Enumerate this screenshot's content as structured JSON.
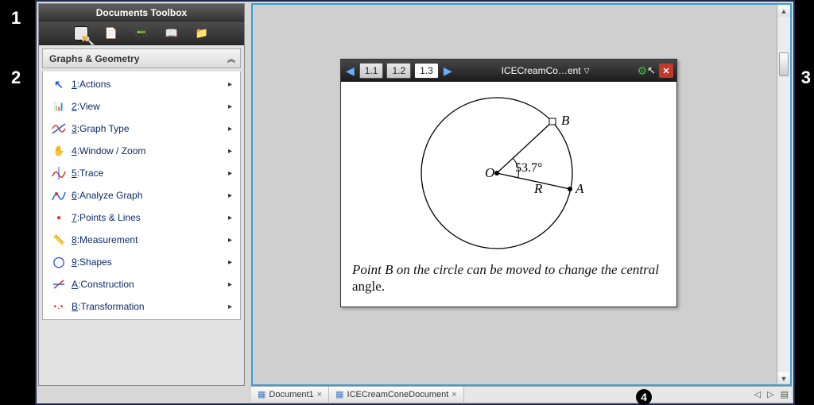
{
  "callouts": {
    "one": "1",
    "two": "2",
    "three": "3",
    "four": "4"
  },
  "toolbox": {
    "title": "Documents Toolbox",
    "panel_header": "Graphs & Geometry",
    "items": [
      {
        "key": "1",
        "label": "Actions"
      },
      {
        "key": "2",
        "label": "View"
      },
      {
        "key": "3",
        "label": "Graph Type"
      },
      {
        "key": "4",
        "label": "Window / Zoom"
      },
      {
        "key": "5",
        "label": "Trace"
      },
      {
        "key": "6",
        "label": "Analyze Graph"
      },
      {
        "key": "7",
        "label": "Points & Lines"
      },
      {
        "key": "8",
        "label": "Measurement"
      },
      {
        "key": "9",
        "label": "Shapes"
      },
      {
        "key": "A",
        "label": "Construction"
      },
      {
        "key": "B",
        "label": "Transformation"
      }
    ]
  },
  "docwin": {
    "tabs": [
      "1.1",
      "1.2",
      "1.3"
    ],
    "active_tab": 2,
    "title": "ICECreamCo…ent",
    "geometry": {
      "center_label": "O",
      "point_a": "A",
      "point_b": "B",
      "radius_label": "R",
      "angle": "53.7°"
    },
    "caption_prefix": "Point B on the circle can be moved to change the central ",
    "caption_suffix": "angle."
  },
  "bottom_tabs": {
    "tab1": "Document1",
    "tab2": "ICECreamConeDocument"
  },
  "chart_data": {
    "type": "diagram",
    "shape": "circle",
    "center": "O",
    "points": [
      "A",
      "B"
    ],
    "radius_label": "R",
    "central_angle_deg": 53.7,
    "note": "Point B on the circle can be moved to change the central angle."
  }
}
